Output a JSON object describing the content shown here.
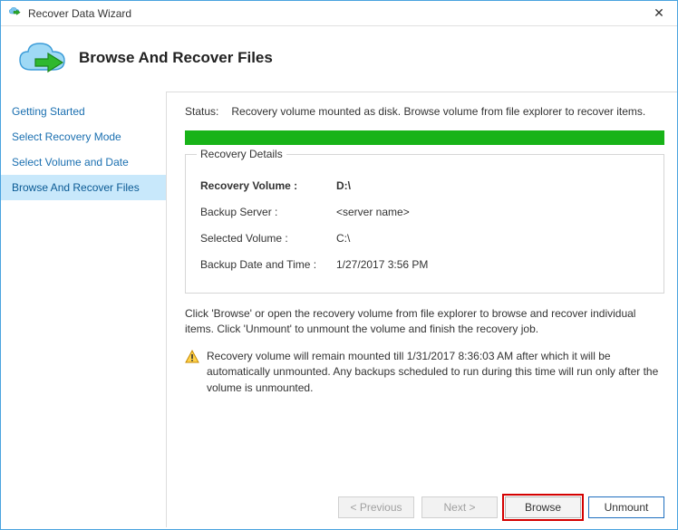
{
  "window": {
    "title": "Recover Data Wizard",
    "close": "✕"
  },
  "header": {
    "heading": "Browse And Recover Files"
  },
  "sidebar": {
    "steps": [
      {
        "label": "Getting Started"
      },
      {
        "label": "Select Recovery Mode"
      },
      {
        "label": "Select Volume and Date"
      },
      {
        "label": "Browse And Recover Files"
      }
    ]
  },
  "main": {
    "status_label": "Status:",
    "status_value": "Recovery volume mounted as disk. Browse volume from file explorer to recover items.",
    "details_legend": "Recovery Details",
    "details": {
      "recovery_volume_label": "Recovery Volume :",
      "recovery_volume_value": "D:\\",
      "backup_server_label": "Backup Server :",
      "backup_server_value": "<server name>",
      "selected_volume_label": "Selected Volume :",
      "selected_volume_value": "C:\\",
      "backup_datetime_label": "Backup Date and Time :",
      "backup_datetime_value": "1/27/2017 3:56 PM"
    },
    "instructions": "Click 'Browse' or open the recovery volume from file explorer to browse and recover individual items. Click 'Unmount' to unmount the volume and finish the recovery job.",
    "warning": "Recovery volume will remain mounted till 1/31/2017 8:36:03 AM after which it will be automatically unmounted. Any backups scheduled to run during this time will run only after the volume is unmounted.",
    "buttons": {
      "previous": "< Previous",
      "next": "Next >",
      "browse": "Browse",
      "unmount": "Unmount"
    }
  }
}
